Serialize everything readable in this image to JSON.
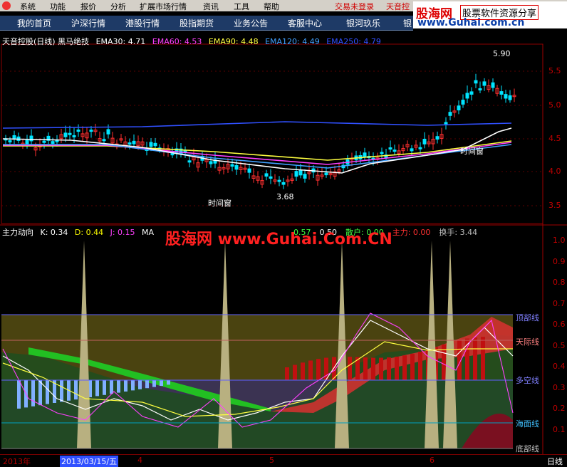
{
  "menu": {
    "items": [
      "系统",
      "功能",
      "报价",
      "分析",
      "扩展市场行情",
      "资讯",
      "工具",
      "帮助"
    ],
    "trade_status": "交易未登录",
    "stock_short": "天音控"
  },
  "nav": {
    "items": [
      "我的首页",
      "沪深行情",
      "港股行情",
      "股指期货",
      "业务公告",
      "客服中心",
      "银河玖乐",
      "银"
    ]
  },
  "brand": {
    "name": "股海网",
    "slogan": "股票软件资源分享",
    "url": "www.Guhai.com.cn"
  },
  "price_panel": {
    "title": "天音控股(日线) 黑马绝技",
    "ema": [
      {
        "label": "EMA30: 4.71",
        "color": "#ffffff"
      },
      {
        "label": "EMA60: 4.53",
        "color": "#ff40ff"
      },
      {
        "label": "EMA90: 4.48",
        "color": "#ffff40"
      },
      {
        "label": "EMA120: 4.49",
        "color": "#40a0ff"
      },
      {
        "label": "EMA250: 4.79",
        "color": "#3050ff"
      }
    ],
    "y_ticks": [
      "5.5",
      "5.0",
      "4.5",
      "4.0",
      "3.5"
    ],
    "high_label": "5.90",
    "low_label": "3.68",
    "window_label": "时间窗"
  },
  "indicator_panel": {
    "title": "主力动向",
    "fields": [
      {
        "label": "K: 0.34",
        "color": "#ffffff"
      },
      {
        "label": "D: 0.44",
        "color": "#ffff00"
      },
      {
        "label": "J: 0.15",
        "color": "#ff40ff"
      },
      {
        "label": "MA",
        "color": "#ffffff"
      }
    ],
    "right_fields": [
      {
        "label": "0.57",
        "color": "#40ff40"
      },
      {
        "label": "0.50",
        "color": "#ffffff"
      },
      {
        "label": "散户: 0.00",
        "color": "#40ff40"
      },
      {
        "label": "主力: 0.00",
        "color": "#ff3030"
      },
      {
        "label": "换手: 3.44",
        "color": "#c0c0c0"
      }
    ],
    "y_ticks": [
      "1.0",
      "0.9",
      "0.8",
      "0.7",
      "0.6",
      "0.5",
      "0.4",
      "0.3",
      "0.2",
      "0.1"
    ],
    "zones": [
      "顶部线",
      "天际线",
      "多空线",
      "海面线",
      "底部线"
    ]
  },
  "watermark": "股海网 www.Guhai.Com.CN",
  "timeline": {
    "labels": [
      "2013年",
      "2013/03/15/五",
      "4",
      "5",
      "6"
    ],
    "period": "日线"
  },
  "colors": {
    "up": "#ff3030",
    "down": "#00e5ff",
    "grid": "#8b0000",
    "panel_border": "#a00000"
  }
}
